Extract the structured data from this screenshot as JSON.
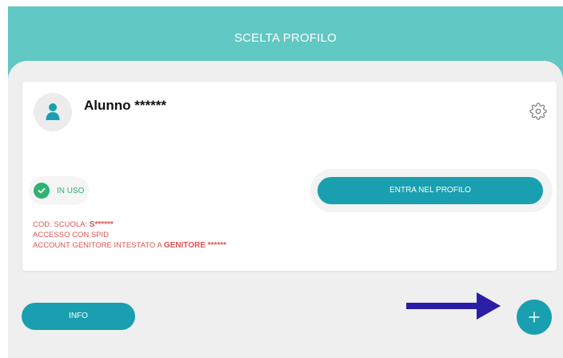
{
  "header": {
    "title": "SCELTA PROFILO"
  },
  "profile_card": {
    "name": "Alunno ******",
    "status_label": "IN USO",
    "enter_button_label": "ENTRA NEL PROFILO",
    "school_code_prefix": "COD. SCUOLA: ",
    "school_code_value": "S******",
    "access_method": "ACCESSO CON SPID",
    "account_owner_prefix": "ACCOUNT GENITORE INTESTATO A ",
    "account_owner_name": "GENITORE ******"
  },
  "footer": {
    "info_button_label": "INFO",
    "add_button_label": "+"
  },
  "icons": {
    "avatar": "person-icon",
    "settings": "gear-icon",
    "status": "check-circle-icon",
    "pointer": "arrow-right-icon"
  },
  "colors": {
    "header": "#61c8c3",
    "background": "#efefef",
    "primary_button": "#1a9fb0",
    "success": "#2eb372",
    "warning_text": "#e05151",
    "arrow": "#2b1ea6",
    "avatar_icon": "#1a9fb0"
  }
}
